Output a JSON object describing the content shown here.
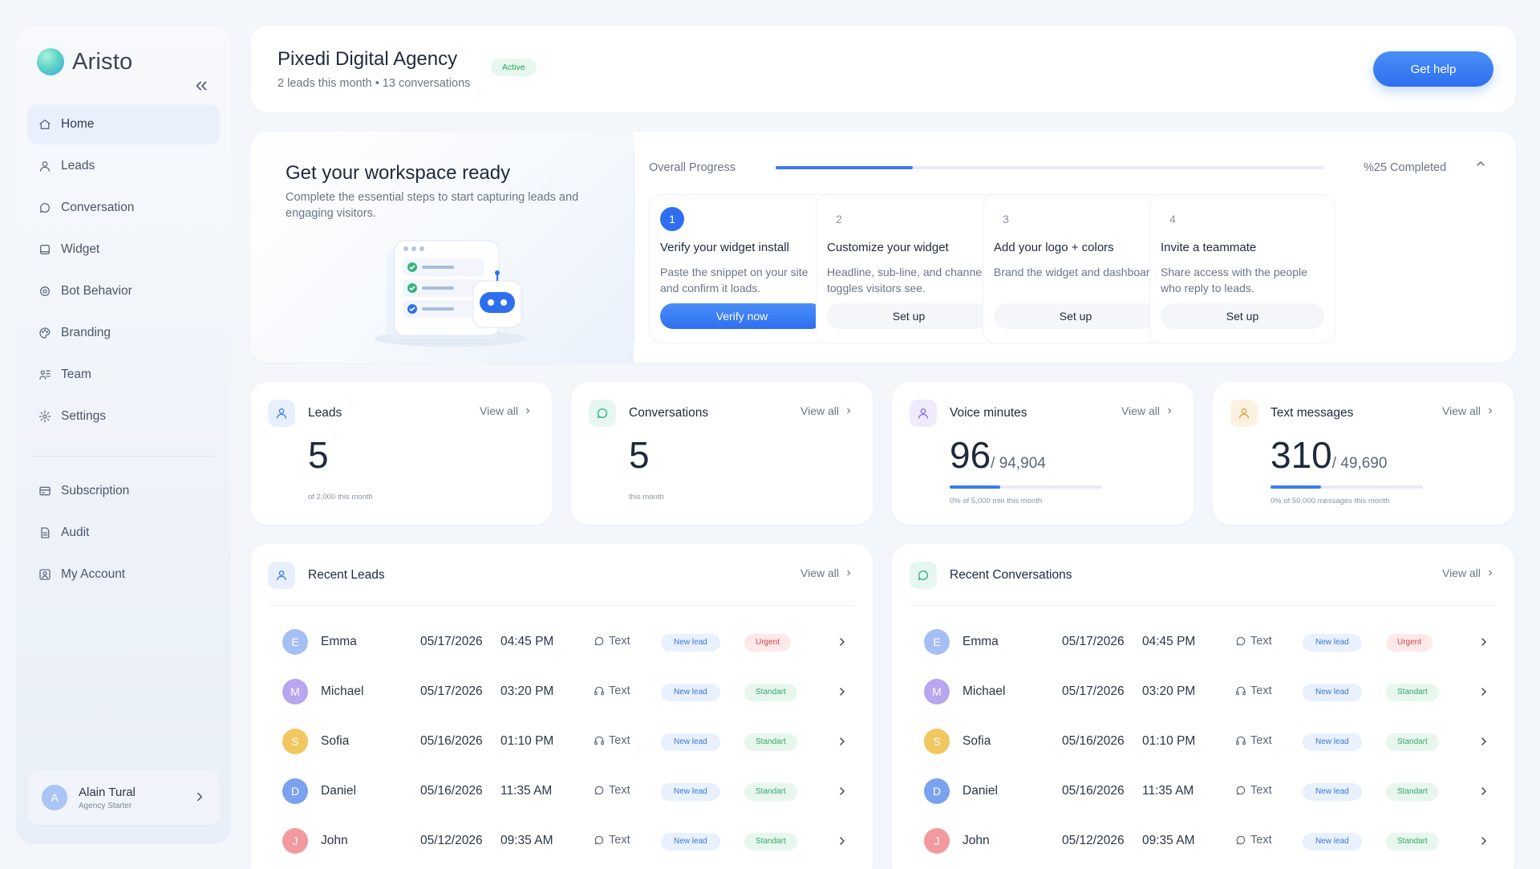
{
  "brand": {
    "name": "Aristo"
  },
  "nav": [
    {
      "label": "Home",
      "icon": "home-icon",
      "active": true
    },
    {
      "label": "Leads",
      "icon": "user-icon"
    },
    {
      "label": "Conversation",
      "icon": "chat-icon"
    },
    {
      "label": "Widget",
      "icon": "widget-icon"
    },
    {
      "label": "Bot Behavior",
      "icon": "bot-icon"
    },
    {
      "label": "Branding",
      "icon": "palette-icon"
    },
    {
      "label": "Team",
      "icon": "team-icon"
    },
    {
      "label": "Settings",
      "icon": "gear-icon"
    }
  ],
  "nav_secondary": [
    {
      "label": "Subscription",
      "icon": "card-icon"
    },
    {
      "label": "Audit",
      "icon": "document-icon"
    },
    {
      "label": "My Account",
      "icon": "account-icon"
    }
  ],
  "user": {
    "initial": "A",
    "name": "Alain Tural",
    "plan": "Agency Starter"
  },
  "header": {
    "title": "Pixedi Digital Agency",
    "subtitle": "2 leads this month • 13 conversations",
    "status": "Active",
    "help_label": "Get help"
  },
  "workspace": {
    "title": "Get your workspace ready",
    "description": "Complete the essential steps to start capturing leads and engaging visitors.",
    "progress_label": "Overall Progress",
    "progress_value": 0.25,
    "progress_text": "%25 Completed",
    "steps": [
      {
        "num": "1",
        "title": "Verify your widget install",
        "desc": "Paste the snippet on your site and confirm it loads.",
        "button": "Verify now",
        "active": true
      },
      {
        "num": "2",
        "title": "Customize your widget",
        "desc": "Headline, sub-line, and channel toggles visitors see.",
        "button": "Set up",
        "active": false
      },
      {
        "num": "3",
        "title": "Add your logo + colors",
        "desc": "Brand the widget and dashboard.",
        "button": "Set up",
        "active": false
      },
      {
        "num": "4",
        "title": "Invite a teammate",
        "desc": "Share access with the people who reply to leads.",
        "button": "Set up",
        "active": false
      }
    ]
  },
  "stats": [
    {
      "title": "Leads",
      "view": "View all",
      "value": "5",
      "of": "",
      "note": "of 2,000 this month",
      "bar": null,
      "icon": "user-icon",
      "tint": "#e8f0fd",
      "color": "#3b7af3"
    },
    {
      "title": "Conversations",
      "view": "View all",
      "value": "5",
      "of": "",
      "note": "this month",
      "bar": null,
      "icon": "chat-icon",
      "tint": "#e6f6f1",
      "color": "#2fae86"
    },
    {
      "title": "Voice minutes",
      "view": "View all",
      "value": "96",
      "of": "/ 94,904",
      "note": "0% of 5,000 min this month",
      "bar": 0.33,
      "icon": "user-icon",
      "tint": "#efeafc",
      "color": "#8a6fd8"
    },
    {
      "title": "Text messages",
      "view": "View all",
      "value": "310",
      "of": "/ 49,690",
      "note": "0% of 50,000 messages this month",
      "bar": 0.33,
      "icon": "user-icon",
      "tint": "#fdf1e0",
      "color": "#e3a13a"
    }
  ],
  "recent_leads": {
    "title": "Recent Leads",
    "view": "View all",
    "rows": [
      {
        "initial": "E",
        "name": "Emma",
        "date": "05/17/2026",
        "time": "04:45 PM",
        "channel": "Text",
        "channel_icon": "chat-icon",
        "tag": "New lead",
        "priority": "Urgent",
        "avatar": "#a5bff4"
      },
      {
        "initial": "M",
        "name": "Michael",
        "date": "05/17/2026",
        "time": "03:20 PM",
        "channel": "Text",
        "channel_icon": "headset-icon",
        "tag": "New lead",
        "priority": "Standart",
        "avatar": "#b8a6ef"
      },
      {
        "initial": "S",
        "name": "Sofia",
        "date": "05/16/2026",
        "time": "01:10 PM",
        "channel": "Text",
        "channel_icon": "headset-icon",
        "tag": "New lead",
        "priority": "Standart",
        "avatar": "#f0c760"
      },
      {
        "initial": "D",
        "name": "Daniel",
        "date": "05/16/2026",
        "time": "11:35 AM",
        "channel": "Text",
        "channel_icon": "chat-icon",
        "tag": "New lead",
        "priority": "Standart",
        "avatar": "#7aa2ee"
      },
      {
        "initial": "J",
        "name": "John",
        "date": "05/12/2026",
        "time": "09:35 AM",
        "channel": "Text",
        "channel_icon": "chat-icon",
        "tag": "New lead",
        "priority": "Standart",
        "avatar": "#f29a9e"
      }
    ]
  },
  "recent_conversations": {
    "title": "Recent Conversations",
    "view": "View all",
    "rows": [
      {
        "initial": "E",
        "name": "Emma",
        "date": "05/17/2026",
        "time": "04:45 PM",
        "channel": "Text",
        "channel_icon": "chat-icon",
        "tag": "New lead",
        "priority": "Urgent",
        "avatar": "#a5bff4"
      },
      {
        "initial": "M",
        "name": "Michael",
        "date": "05/17/2026",
        "time": "03:20 PM",
        "channel": "Text",
        "channel_icon": "headset-icon",
        "tag": "New lead",
        "priority": "Standart",
        "avatar": "#b8a6ef"
      },
      {
        "initial": "S",
        "name": "Sofia",
        "date": "05/16/2026",
        "time": "01:10 PM",
        "channel": "Text",
        "channel_icon": "headset-icon",
        "tag": "New lead",
        "priority": "Standart",
        "avatar": "#f0c760"
      },
      {
        "initial": "D",
        "name": "Daniel",
        "date": "05/16/2026",
        "time": "11:35 AM",
        "channel": "Text",
        "channel_icon": "chat-icon",
        "tag": "New lead",
        "priority": "Standart",
        "avatar": "#7aa2ee"
      },
      {
        "initial": "J",
        "name": "John",
        "date": "05/12/2026",
        "time": "09:35 AM",
        "channel": "Text",
        "channel_icon": "chat-icon",
        "tag": "New lead",
        "priority": "Standart",
        "avatar": "#f29a9e"
      }
    ]
  }
}
